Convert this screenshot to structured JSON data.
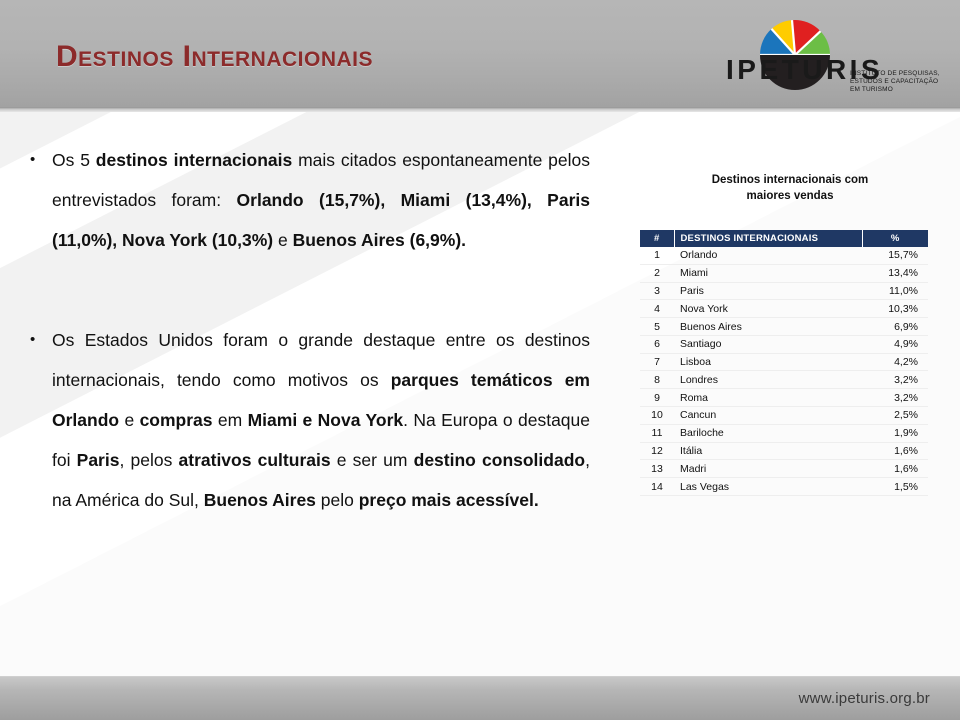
{
  "header": {
    "title": "Destinos Internacionais",
    "accent_color": "#8C2B2B",
    "band_color": "#B2B2B2"
  },
  "logo": {
    "wordmark": "IPETURIS",
    "tagline": "INSTITUTO DE PESQUISAS, ESTUDOS E CAPACITAÇÃO EM TURISMO",
    "mark_name": "ipeturis-fan-logo",
    "segment_colors": [
      "#1B75BC",
      "#FFCC00",
      "#E02020",
      "#6CBE45"
    ],
    "base_color": "#231F20"
  },
  "bullets": [
    {
      "marker": "•",
      "line1_plain_a": "Os 5 ",
      "line1_bold_a": "destinos internacionais",
      "line1_plain_b": " mais citados espontaneamente pelos entrevistados foram: ",
      "line2_bold": "Orlando (15,7%), Miami (13,4%), Paris (11,0%), Nova York (10,3%)",
      "line2_plain": " e ",
      "line3_bold": "Buenos Aires (6,9%)."
    }
  ],
  "body": {
    "bullet1": {
      "marker": "•",
      "seg1": "Os 5 ",
      "seg2_bold": "destinos internacionais",
      "seg3": " mais citados espontaneamente pelos entrevistados foram: ",
      "seg4_bold": "Orlando (15,7%), Miami (13,4%), Paris (11,0%), Nova York (10,3%)",
      "seg5": " e ",
      "seg6_bold": "Buenos Aires (6,9%)."
    },
    "bullet2": {
      "marker": "•",
      "seg1": "Os Estados Unidos foram o grande destaque entre os destinos internacionais, tendo como motivos os ",
      "seg2_bold": "parques temáticos em Orlando",
      "seg3": " e ",
      "seg4_bold": "compras",
      "seg5": " em ",
      "seg6_bold": "Miami e Nova York",
      "seg7": ". Na Europa o destaque foi ",
      "seg8_bold": "Paris",
      "seg9": ", pelos ",
      "seg10_bold": "atrativos culturais",
      "seg11": " e ser um ",
      "seg12_bold": "destino consolidado",
      "seg13": ", na América do Sul, ",
      "seg14_bold": "Buenos Aires",
      "seg15": " pelo ",
      "seg16_bold": "preço mais acessível."
    }
  },
  "table": {
    "caption_line1": "Destinos internacionais com",
    "caption_line2": "maiores vendas",
    "header_bg": "#1F3864",
    "columns": [
      "#",
      "DESTINOS INTERNACIONAIS",
      "%"
    ],
    "rows": [
      {
        "rank": "1",
        "destination": "Orlando",
        "pct": "15,7%"
      },
      {
        "rank": "2",
        "destination": "Miami",
        "pct": "13,4%"
      },
      {
        "rank": "3",
        "destination": "Paris",
        "pct": "11,0%"
      },
      {
        "rank": "4",
        "destination": "Nova York",
        "pct": "10,3%"
      },
      {
        "rank": "5",
        "destination": "Buenos Aires",
        "pct": "6,9%"
      },
      {
        "rank": "6",
        "destination": "Santiago",
        "pct": "4,9%"
      },
      {
        "rank": "7",
        "destination": "Lisboa",
        "pct": "4,2%"
      },
      {
        "rank": "8",
        "destination": "Londres",
        "pct": "3,2%"
      },
      {
        "rank": "9",
        "destination": "Roma",
        "pct": "3,2%"
      },
      {
        "rank": "10",
        "destination": "Cancun",
        "pct": "2,5%"
      },
      {
        "rank": "11",
        "destination": "Bariloche",
        "pct": "1,9%"
      },
      {
        "rank": "12",
        "destination": "Itália",
        "pct": "1,6%"
      },
      {
        "rank": "13",
        "destination": "Madri",
        "pct": "1,6%"
      },
      {
        "rank": "14",
        "destination": "Las Vegas",
        "pct": "1,5%"
      }
    ]
  },
  "footer": {
    "url": "www.ipeturis.org.br"
  }
}
